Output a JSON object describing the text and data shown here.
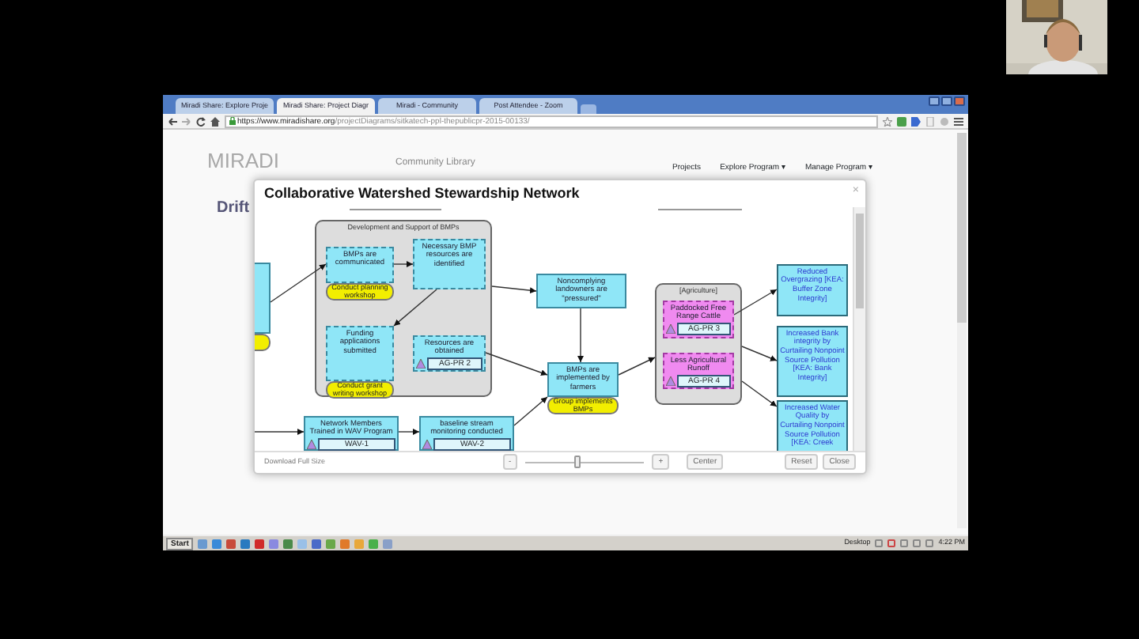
{
  "browser": {
    "tabs": [
      {
        "label": "Miradi Share: Explore Proje",
        "selected": false
      },
      {
        "label": "Miradi Share: Project Diagr",
        "selected": true
      },
      {
        "label": "Miradi - Community",
        "selected": false
      },
      {
        "label": "Post Attendee - Zoom",
        "selected": false
      }
    ],
    "url_host": "https://www.miradishare.org",
    "url_path": "/projectDiagrams/sitkatech-ppl-thepublicpr-2015-00133/"
  },
  "page": {
    "logo": "MIRADI",
    "library": "Community Library",
    "nav": [
      "Projects",
      "Explore Program ▾",
      "Manage Program ▾"
    ],
    "heading": "Drift"
  },
  "modal": {
    "title": "Collaborative Watershed Stewardship Network",
    "close": "×",
    "groups": [
      {
        "label": "Development and Support of BMPs"
      },
      {
        "label": "[Agriculture]"
      }
    ],
    "nodes": [
      {
        "kind": "result",
        "dashed": true,
        "text": "BMPs are communicated",
        "strategy": "Conduct planning workshop"
      },
      {
        "kind": "result",
        "dashed": true,
        "text": "Necessary BMP resources are identified"
      },
      {
        "kind": "result",
        "dashed": true,
        "text": "Funding applications submitted",
        "strategy": "Conduct grant writing workshop"
      },
      {
        "kind": "result",
        "dashed": true,
        "text": "Resources are obtained",
        "indicator": "AG-PR 2"
      },
      {
        "kind": "result",
        "dashed": false,
        "text": "Network Members Trained in WAV Program",
        "indicator": "WAV-1"
      },
      {
        "kind": "result",
        "dashed": false,
        "text": "baseline stream monitoring conducted",
        "indicator": "WAV-2"
      },
      {
        "kind": "result",
        "dashed": false,
        "text": "Noncomplying landowners are \"pressured\""
      },
      {
        "kind": "result",
        "dashed": false,
        "text": "BMPs are implemented by farmers",
        "strategy": "Group implements BMPs"
      },
      {
        "kind": "threat-reduction",
        "dashed": true,
        "text": "Paddocked Free Range Cattle",
        "indicator": "AG-PR 3"
      },
      {
        "kind": "threat-reduction",
        "dashed": true,
        "text": "Less Agricultural Runoff",
        "indicator": "AG-PR 4"
      },
      {
        "kind": "outcome",
        "dashed": false,
        "text": "Reduced Overgrazing [KEA: Buffer Zone Integrity]"
      },
      {
        "kind": "outcome",
        "dashed": false,
        "text": "Increased Bank integrity by Curtailing Nonpoint Source Pollution [KEA: Bank Integrity]"
      },
      {
        "kind": "outcome",
        "dashed": false,
        "text": "Increased Water Quality by Curtailing Nonpoint Source Pollution [KEA: Creek"
      }
    ],
    "footer": {
      "download": "Download Full Size",
      "zoom_out": "-",
      "zoom": {
        "level": 0.44
      },
      "zoom_in": "+",
      "center": "Center",
      "reset": "Reset",
      "close": "Close"
    }
  },
  "taskbar": {
    "start": "Start",
    "tray_label": "Desktop",
    "time": "4:22 PM"
  }
}
